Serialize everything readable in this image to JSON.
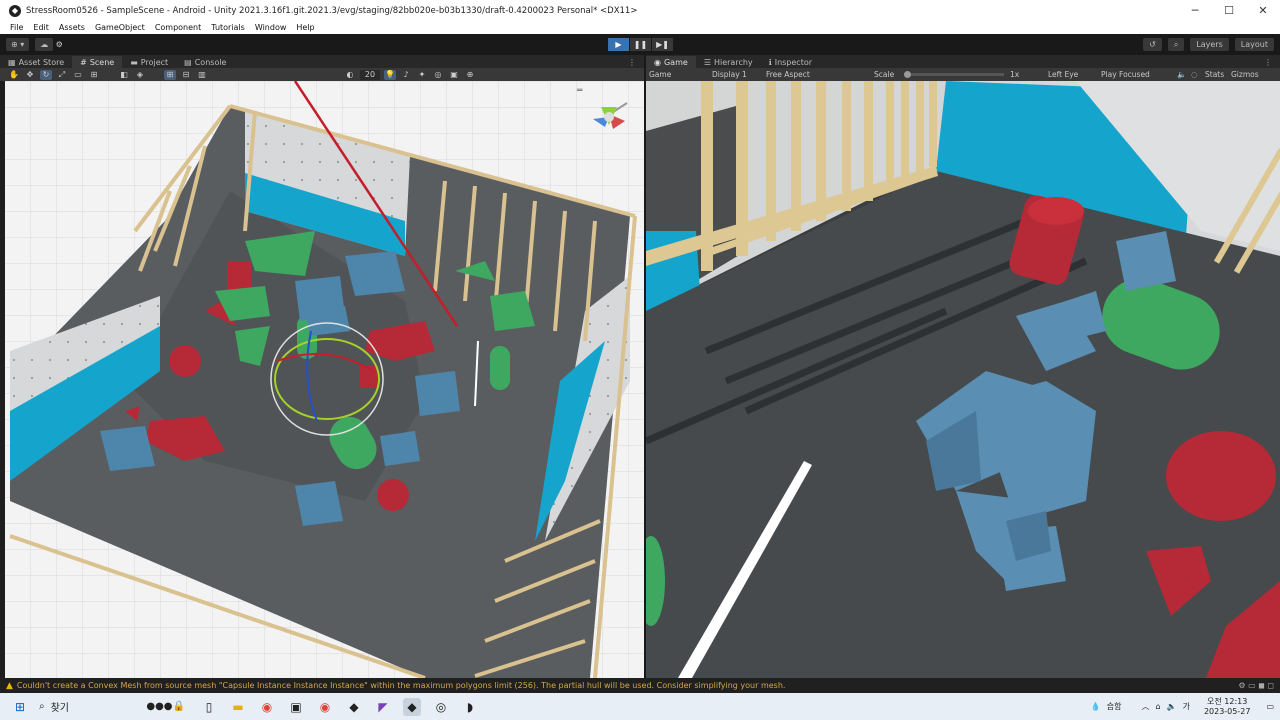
{
  "window": {
    "title": "StressRoom0526 - SampleScene - Android - Unity 2021.3.16f1.git.2021.3/evg/staging/82bb020e-b03b1330/draft-0.4200023 Personal* <DX11>"
  },
  "menu": [
    "File",
    "Edit",
    "Assets",
    "GameObject",
    "Component",
    "Tutorials",
    "Window",
    "Help"
  ],
  "toolbar": {
    "account_label": "⊕ ▾",
    "layers_label": "Layers",
    "layout_label": "Layout"
  },
  "left_tabs": [
    "Asset Store",
    "Scene",
    "Project",
    "Console"
  ],
  "right_tabs": [
    "Game",
    "Hierarchy",
    "Inspector"
  ],
  "scene_toolbar": {
    "icon_size": "20"
  },
  "game_toolbar": {
    "mode": "Game",
    "display": "Display 1",
    "aspect": "Free Aspect",
    "scale_label": "Scale",
    "scale_value": "1x",
    "eye": "Left Eye",
    "play_mode": "Play Focused",
    "stats": "Stats",
    "gizmos": "Gizmos"
  },
  "console": {
    "message": "Couldn't create a Convex Mesh from source mesh \"Capsule Instance Instance Instance\" within the maximum polygons limit (256). The partial hull will be used. Consider simplifying your mesh."
  },
  "taskbar": {
    "search_placeholder": "찾기",
    "weather": "습함",
    "time": "오전 12:13",
    "date": "2023-05-27"
  },
  "colors": {
    "play_active": "#3a72b0",
    "warning": "#e6b800",
    "shape_red": "#b52a36",
    "shape_green": "#3fa860",
    "shape_blue": "#4e86ab",
    "wall_blue": "#15a4cc"
  }
}
